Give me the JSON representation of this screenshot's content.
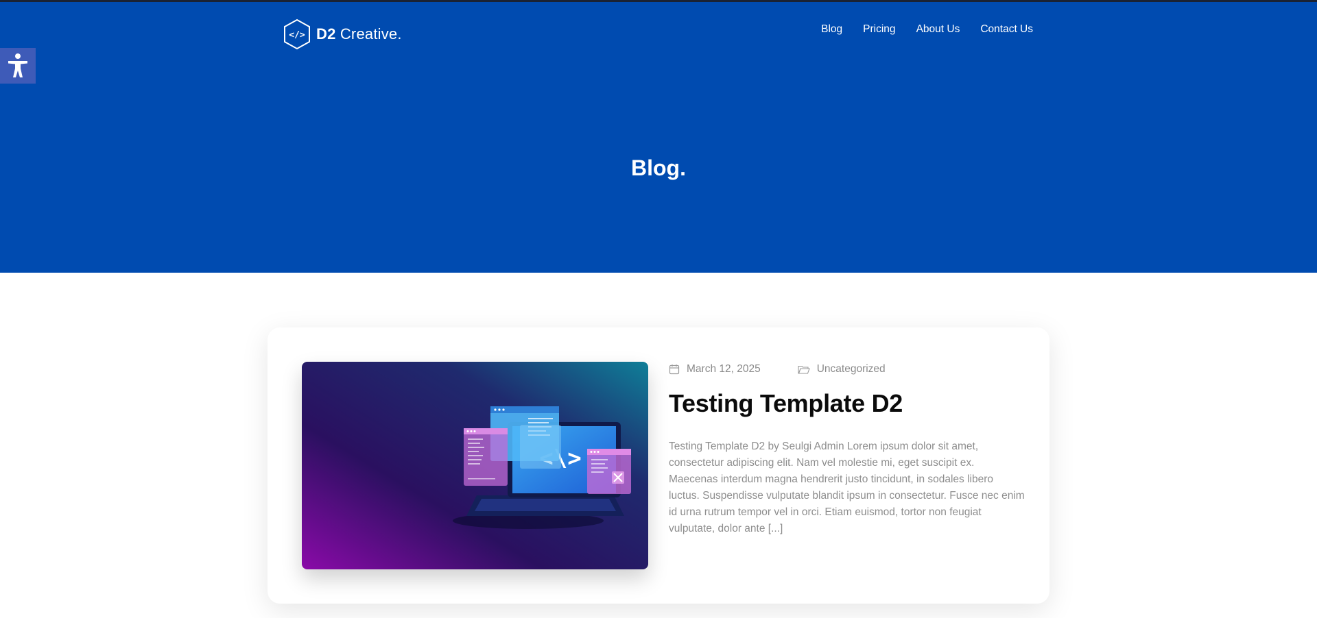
{
  "site": {
    "logo_bold": "D2",
    "logo_rest": " Creative."
  },
  "nav": {
    "items": [
      {
        "label": "Blog"
      },
      {
        "label": "Pricing"
      },
      {
        "label": "About Us"
      },
      {
        "label": "Contact Us"
      }
    ]
  },
  "accessibility": {
    "icon": "accessibility-icon"
  },
  "hero": {
    "title": "Blog."
  },
  "post": {
    "date": "March 12, 2025",
    "category": "Uncategorized",
    "title": "Testing Template D2",
    "excerpt": "Testing Template D2 by Seulgi Admin Lorem ipsum dolor sit amet, consectetur adipiscing elit. Nam vel molestie mi, eget suscipit ex. Maecenas interdum magna hendrerit justo tincidunt, in sodales libero luctus. Suspendisse vulputate blandit ipsum in consectetur. Fusce nec enim id urna rutrum tempor vel in orci. Etiam euismod, tortor non feugiat vulputate, dolor ante [...]"
  },
  "colors": {
    "brand": "#004bb0",
    "accessibility": "#3e5bb8",
    "meta_text": "#8a8a8a",
    "title_text": "#0b0b0b"
  }
}
